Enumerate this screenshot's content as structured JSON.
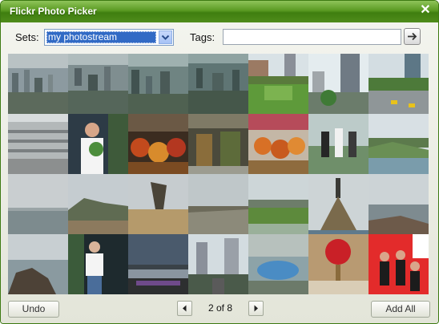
{
  "window": {
    "title": "Flickr Photo Picker"
  },
  "sets": {
    "label": "Sets:",
    "selected": "my photostream"
  },
  "tags": {
    "label": "Tags:",
    "value": ""
  },
  "pager": {
    "text": "2 of 8"
  },
  "buttons": {
    "undo": "Undo",
    "add_all": "Add All"
  },
  "icons": {
    "close": "close-icon",
    "dropdown": "chevron-down-icon",
    "go": "arrow-right-icon",
    "prev": "triangle-left-icon",
    "next": "triangle-right-icon"
  }
}
